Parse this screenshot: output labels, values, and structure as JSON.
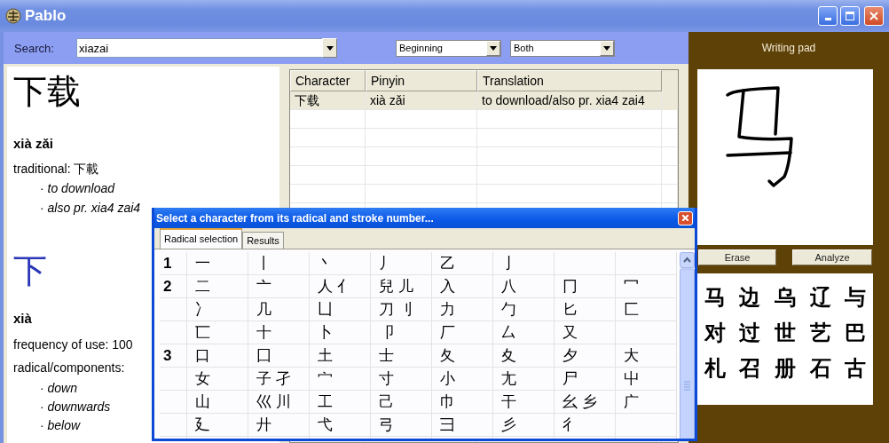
{
  "window": {
    "title": "Pablo"
  },
  "search": {
    "label": "Search:",
    "value": "xiazai",
    "match": "Beginning",
    "scope": "Both"
  },
  "entry": {
    "word": "下载",
    "pinyin": "xià zǎi",
    "traditional": "traditional: 下載",
    "meanings": [
      "· to download",
      "· also pr. xia4 zai4"
    ]
  },
  "character": {
    "char": "下",
    "pinyin": "xià",
    "frequency": "frequency of use: 100",
    "radical": "radical/components:",
    "meanings": [
      "· down",
      "· downwards",
      "· below"
    ]
  },
  "table": {
    "columns": [
      "Character",
      "Pinyin",
      "Translation"
    ],
    "rows": [
      {
        "cells": [
          "下载",
          "xià zǎi",
          "to download/also pr. xia4 zai4"
        ],
        "selected": true
      }
    ]
  },
  "writing_pad": {
    "title": "Writing pad",
    "buttons": [
      "Erase",
      "Analyze"
    ],
    "candidates": [
      "马",
      "边",
      "乌",
      "辽",
      "与",
      "对",
      "过",
      "世",
      "艺",
      "巴",
      "札",
      "召",
      "册",
      "石",
      "古"
    ]
  },
  "dialog": {
    "title": "Select a character from its radical and stroke number...",
    "tabs": [
      {
        "label": "Radical selection",
        "selected": true
      },
      {
        "label": "Results",
        "selected": false
      }
    ],
    "rows": [
      {
        "strokes": "1",
        "cells": [
          "一",
          "丨",
          "丶",
          "丿",
          "乙",
          "亅"
        ]
      },
      {
        "strokes": "2",
        "cells": [
          "二",
          "亠",
          "人 亻",
          "兒 儿",
          "入",
          "八",
          "冂",
          "冖"
        ]
      },
      {
        "cells": [
          "冫",
          "几",
          "凵",
          "刀 刂",
          "力",
          "勹",
          "匕",
          "匚"
        ]
      },
      {
        "cells": [
          "匸",
          "十",
          "卜",
          "卩",
          "厂",
          "厶",
          "又"
        ]
      },
      {
        "strokes": "3",
        "cells": [
          "口",
          "囗",
          "土",
          "士",
          "夂",
          "夊",
          "夕",
          "大"
        ]
      },
      {
        "cells": [
          "女",
          "子 孑",
          "宀",
          "寸",
          "小",
          "尢",
          "尸",
          "屮"
        ]
      },
      {
        "cells": [
          "山",
          "巛 川",
          "工",
          "己",
          "巾",
          "干",
          "幺 乡",
          "广"
        ]
      },
      {
        "cells": [
          "廴",
          "廾",
          "弋",
          "弓",
          "彐",
          "彡",
          "彳"
        ]
      }
    ]
  }
}
